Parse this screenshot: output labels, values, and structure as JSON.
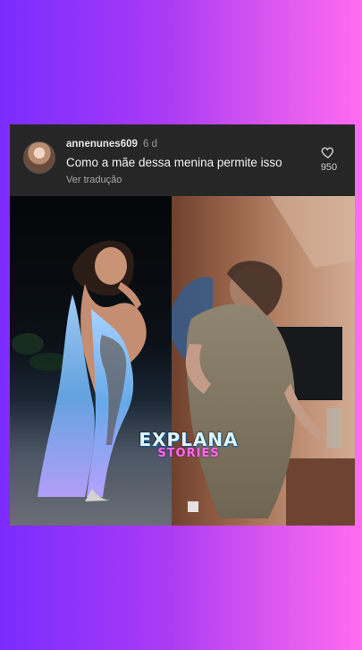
{
  "comment": {
    "username": "annenunes609",
    "time": "6 d",
    "text": "Como a mãe dessa menina permite isso",
    "translate_label": "Ver tradução",
    "like_count": "950"
  },
  "watermark": {
    "main": "EXPLANA",
    "sub": "STORIES"
  },
  "icons": [
    "avatar",
    "heart-icon"
  ]
}
